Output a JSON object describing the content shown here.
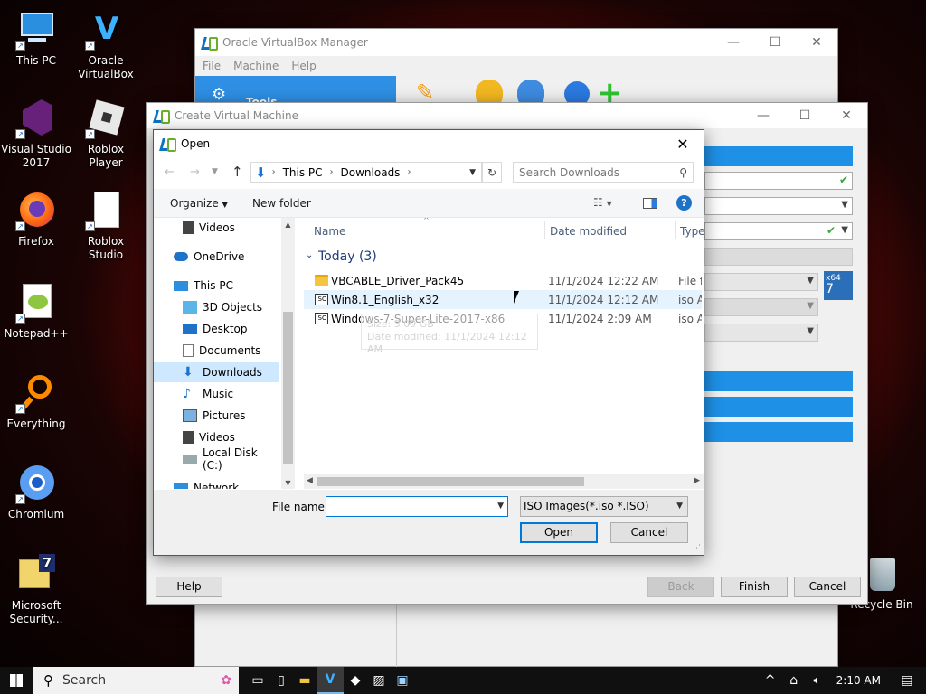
{
  "desktop": {
    "icons": [
      {
        "label": "This PC"
      },
      {
        "label": "Oracle VirtualBox"
      },
      {
        "label": "Visual Studio 2017"
      },
      {
        "label": "Roblox Player"
      },
      {
        "label": "Firefox"
      },
      {
        "label": "Roblox Studio"
      },
      {
        "label": "Notepad++"
      },
      {
        "label": "Everything"
      },
      {
        "label": "Chromium"
      },
      {
        "label": "Microsoft Security..."
      },
      {
        "label": "Recycle Bin"
      }
    ]
  },
  "vbox_manager": {
    "title": "Oracle VirtualBox Manager",
    "menu": [
      "File",
      "Machine",
      "Help"
    ],
    "tools_label": "Tools"
  },
  "create_vm": {
    "title": "Create Virtual Machine",
    "buttons": {
      "help": "Help",
      "back": "Back",
      "finish": "Finish",
      "cancel": "Cancel"
    }
  },
  "open_dialog": {
    "title": "Open",
    "breadcrumb": [
      "This PC",
      "Downloads"
    ],
    "search_placeholder": "Search Downloads",
    "toolbar": {
      "organize": "Organize",
      "new_folder": "New folder"
    },
    "nav": [
      "Videos",
      "OneDrive",
      "This PC",
      "3D Objects",
      "Desktop",
      "Documents",
      "Downloads",
      "Music",
      "Pictures",
      "Videos",
      "Local Disk (C:)",
      "Network"
    ],
    "columns": {
      "name": "Name",
      "date": "Date modified",
      "type": "Type"
    },
    "group": "Today (3)",
    "files": [
      {
        "name": "VBCABLE_Driver_Pack45",
        "date": "11/1/2024 12:22 AM",
        "type": "File folder",
        "icon": "folder-icon"
      },
      {
        "name": "Win8.1_English_x32",
        "date": "11/1/2024 12:12 AM",
        "type": "iso Archive",
        "icon": "iso-icon"
      },
      {
        "name": "Windows-7-Super-Lite-2017-x86",
        "date": "11/1/2024 2:09 AM",
        "type": "iso Archive",
        "icon": "iso-icon"
      }
    ],
    "tooltip": {
      "line1": "Size: 3.09 GB",
      "line2": "Date modified: 11/1/2024 12:12 AM"
    },
    "file_name_label": "File name:",
    "file_name_value": "",
    "filter": "ISO Images(*.iso *.ISO)",
    "open_button": "Open",
    "cancel_button": "Cancel"
  },
  "taskbar": {
    "search_label": "Search",
    "clock": "2:10 AM"
  },
  "colors": {
    "accent": "#0078d7",
    "vbox_blue": "#1e90e6",
    "ok_green": "#3aa53a"
  }
}
